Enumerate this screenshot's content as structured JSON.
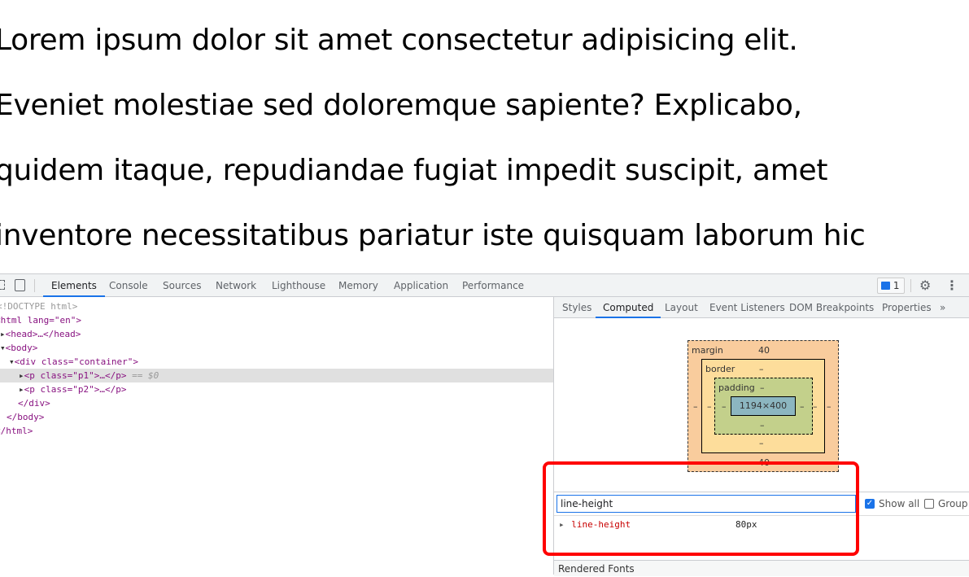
{
  "page_text": [
    "Lorem ipsum dolor sit amet consectetur adipisicing elit.",
    "Eveniet molestiae sed doloremque sapiente? Explicabo,",
    "quidem itaque, repudiandae fugiat impedit suscipit, amet",
    "inventore necessitatibus pariatur iste quisquam laborum hic"
  ],
  "devtools": {
    "tabs": [
      "Elements",
      "Console",
      "Sources",
      "Network",
      "Lighthouse",
      "Memory",
      "Application",
      "Performance"
    ],
    "active_tab": "Elements",
    "issues_count": "1",
    "dom": {
      "doctype": "<!DOCTYPE html>",
      "html_open": "<html lang=\"en\">",
      "head": "<head>…</head>",
      "body_open": "<body>",
      "div_open": "<div class=\"container\">",
      "p1": "<p class=\"p1\">…</p>",
      "p1_suffix": " == $0",
      "p2": "<p class=\"p2\">…</p>",
      "div_close": "</div>",
      "body_close": "</body>",
      "html_close": "</html>"
    },
    "side_tabs": [
      "Styles",
      "Computed",
      "Layout",
      "Event Listeners",
      "DOM Breakpoints",
      "Properties"
    ],
    "active_side_tab": "Computed",
    "box_model": {
      "margin_label": "margin",
      "margin_top": "40",
      "margin_bottom": "40",
      "margin_left": "–",
      "margin_right": "–",
      "border_label": "border",
      "border_top": "–",
      "border_bottom": "–",
      "border_left": "–",
      "border_right": "–",
      "padding_label": "padding",
      "padding_top": "–",
      "padding_bottom": "–",
      "padding_left": "–",
      "padding_right": "–",
      "content": "1194×400"
    },
    "filter": {
      "value": "line-height",
      "show_all_label": "Show all",
      "show_all_checked": true,
      "group_label": "Group",
      "group_checked": false
    },
    "properties": [
      {
        "name": "line-height",
        "value": "80px"
      }
    ],
    "rendered_fonts": "Rendered Fonts"
  },
  "colors": {
    "highlight": "#ff0000",
    "accent": "#1a73e8",
    "margin": "#f9cc9d",
    "border": "#fddd9b",
    "padding": "#c3d08b",
    "content": "#8cb6c0"
  }
}
